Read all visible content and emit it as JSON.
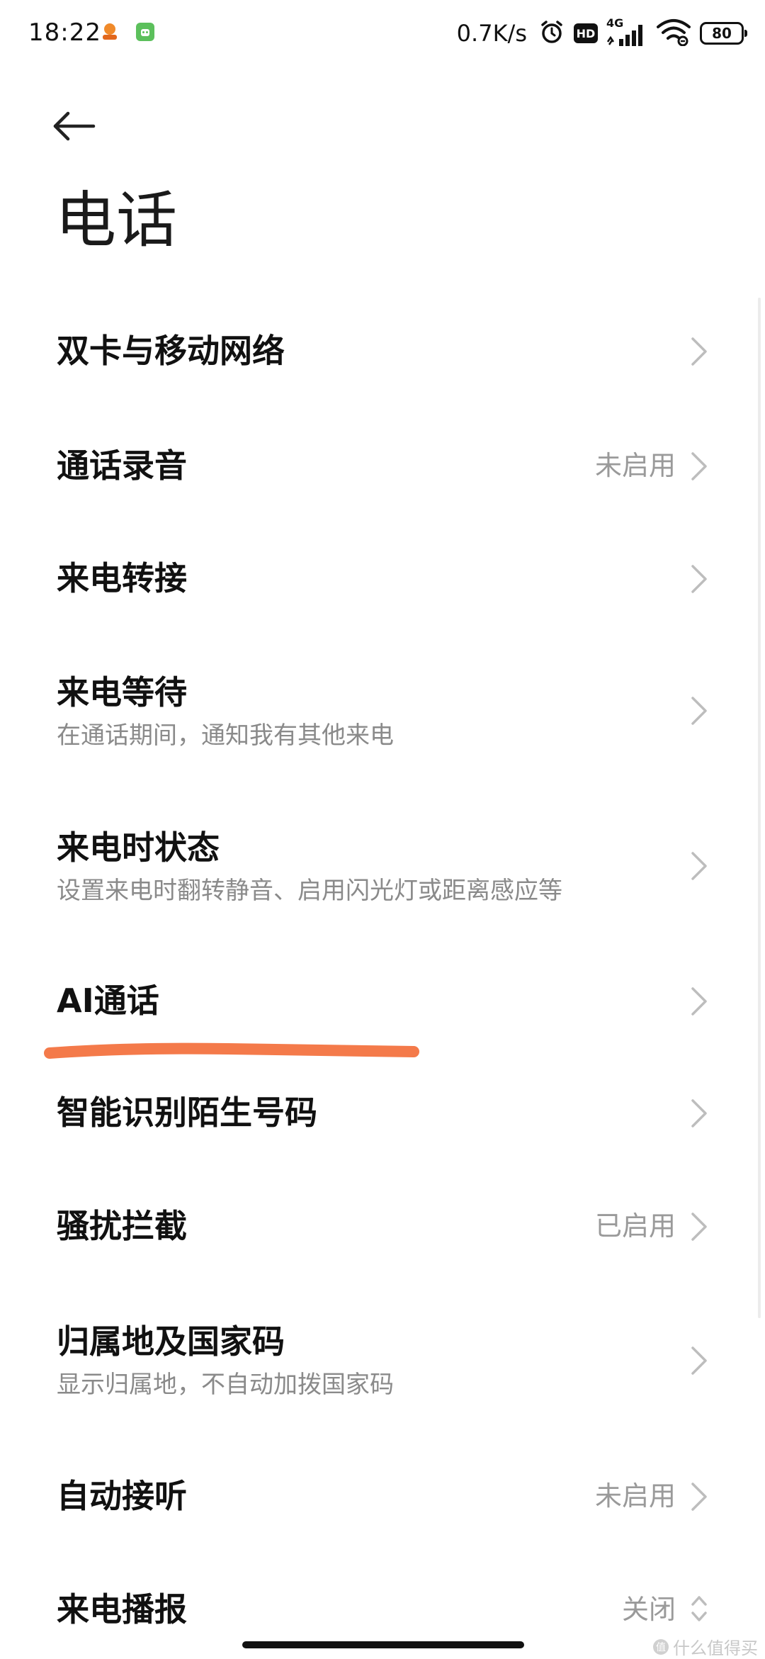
{
  "status_bar": {
    "time": "18:22",
    "net_speed": "0.7K/s",
    "hd": "HD",
    "network": "4G",
    "battery": "80"
  },
  "header": {
    "title": "电话"
  },
  "items": [
    {
      "title": "双卡与移动网络",
      "subtitle": "",
      "value": ""
    },
    {
      "title": "通话录音",
      "subtitle": "",
      "value": "未启用"
    },
    {
      "title": "来电转接",
      "subtitle": "",
      "value": ""
    },
    {
      "title": "来电等待",
      "subtitle": "在通话期间，通知我有其他来电",
      "value": ""
    },
    {
      "title": "来电时状态",
      "subtitle": "设置来电时翻转静音、启用闪光灯或距离感应等",
      "value": ""
    },
    {
      "title": "AI通话",
      "subtitle": "",
      "value": ""
    },
    {
      "title": "智能识别陌生号码",
      "subtitle": "",
      "value": ""
    },
    {
      "title": "骚扰拦截",
      "subtitle": "",
      "value": "已启用"
    },
    {
      "title": "归属地及国家码",
      "subtitle": "显示归属地，不自动加拨国家码",
      "value": ""
    },
    {
      "title": "自动接听",
      "subtitle": "",
      "value": "未启用"
    },
    {
      "title": "来电播报",
      "subtitle": "",
      "value": "关闭"
    }
  ],
  "watermark": "什么值得买",
  "colors": {
    "text": "#111111",
    "secondary": "#8a8a8a",
    "value": "#9a9a9a",
    "chevron": "#bdbdbd",
    "annotation": "#f47a4a"
  },
  "icons": {
    "back": "arrow-left-icon",
    "row_arrow": "chevron-right-icon",
    "selector": "chevron-up-down-icon"
  }
}
